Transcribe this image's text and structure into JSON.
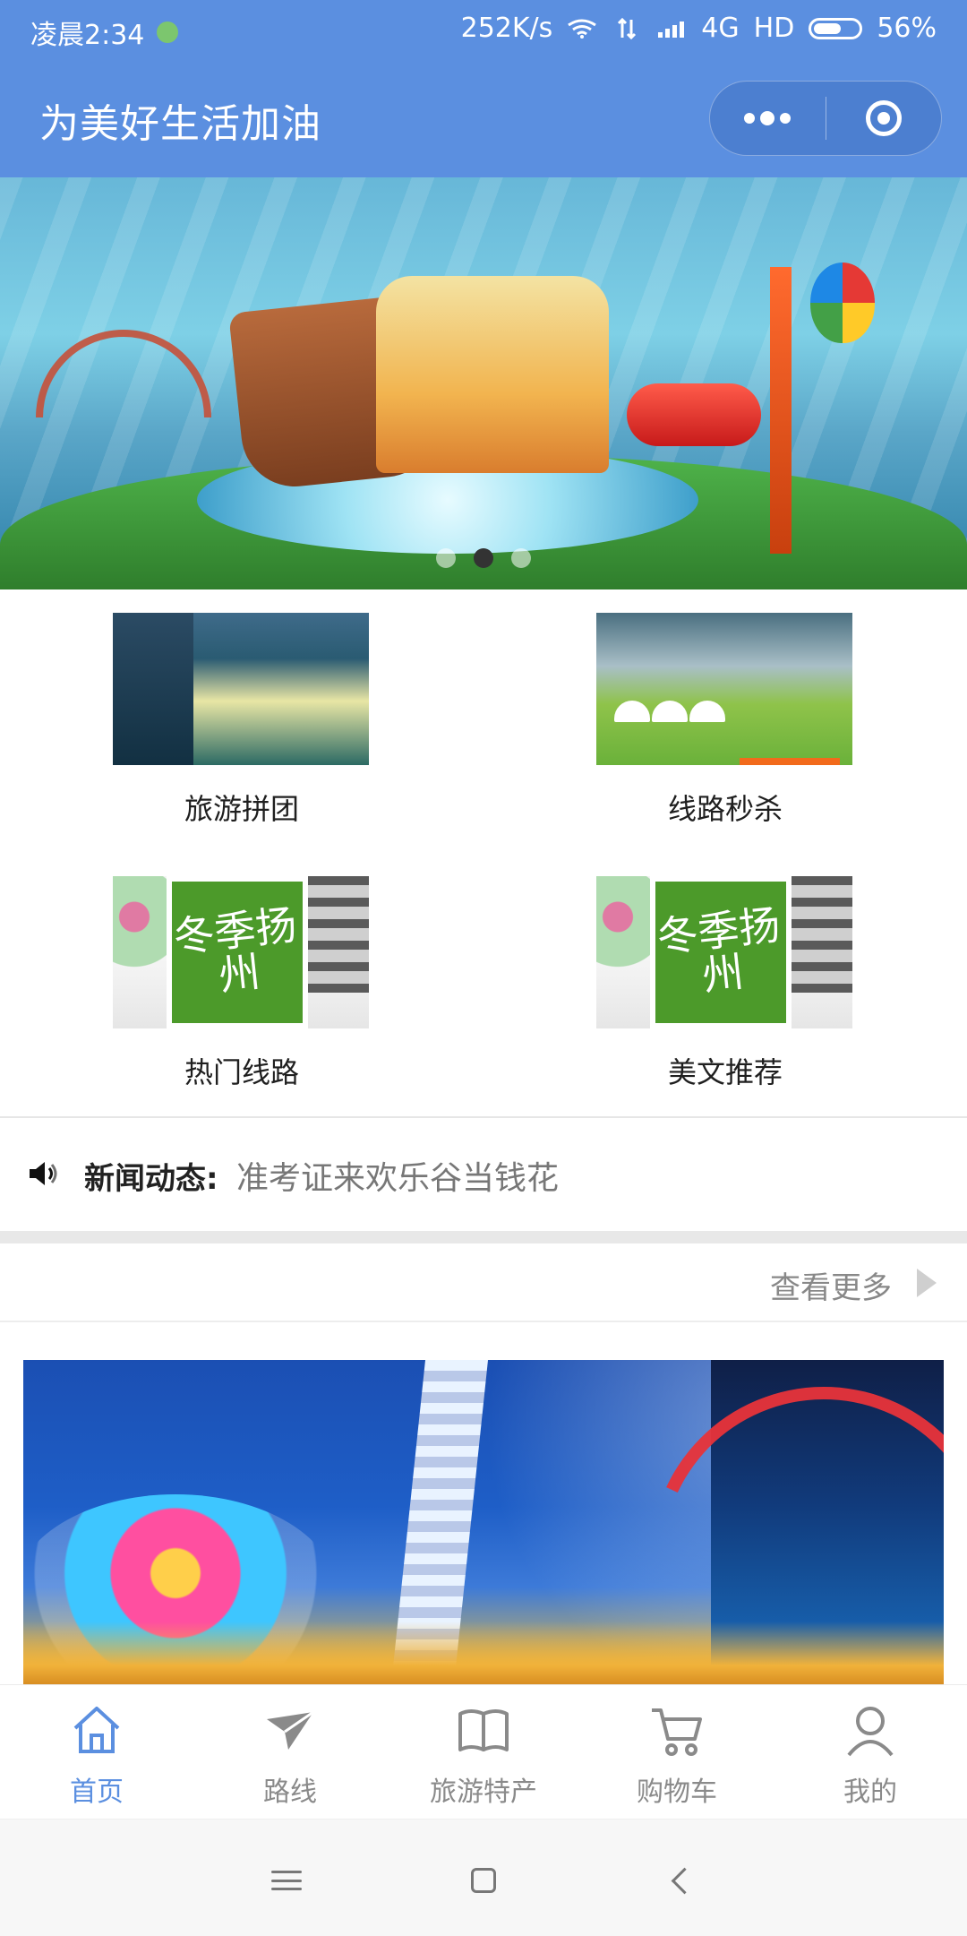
{
  "status_bar": {
    "time": "凌晨2:34",
    "network_speed": "252K/s",
    "network_type": "4G",
    "hd_label": "HD",
    "battery_percent": "56%",
    "icons": [
      "wifi-icon",
      "data-transfer-icon",
      "signal-icon",
      "battery-icon"
    ]
  },
  "header": {
    "title": "为美好生活加油",
    "capsule": {
      "more_icon": "more-dots-icon",
      "close_icon": "record-icon"
    }
  },
  "banner": {
    "active_index": 1,
    "count": 3
  },
  "grid": {
    "items": [
      {
        "label": "旅游拼团",
        "image": "water-town-photo"
      },
      {
        "label": "线路秒杀",
        "image": "yurt-grassland-photo"
      },
      {
        "label": "热门线路",
        "image": "winter-yangzhou-card",
        "season_text": "冬季扬州"
      },
      {
        "label": "美文推荐",
        "image": "winter-yangzhou-card",
        "season_text": "冬季扬州"
      }
    ]
  },
  "news": {
    "label": "新闻动态:",
    "text": "准考证来欢乐谷当钱花",
    "icon": "speaker-icon"
  },
  "more": {
    "label": "查看更多",
    "icon": "chevron-right-icon"
  },
  "feature_image": {
    "description_icons": [
      "swing-ride",
      "drop-tower",
      "roller-coaster"
    ]
  },
  "tabbar": {
    "items": [
      {
        "label": "首页",
        "icon": "home-icon",
        "active": true
      },
      {
        "label": "路线",
        "icon": "paper-plane-icon",
        "active": false
      },
      {
        "label": "旅游特产",
        "icon": "book-icon",
        "active": false
      },
      {
        "label": "购物车",
        "icon": "cart-icon",
        "active": false
      },
      {
        "label": "我的",
        "icon": "user-icon",
        "active": false
      }
    ]
  },
  "colors": {
    "primary": "#5b8fe0",
    "tab_inactive": "#8a8a8a",
    "news_text": "#777777"
  }
}
